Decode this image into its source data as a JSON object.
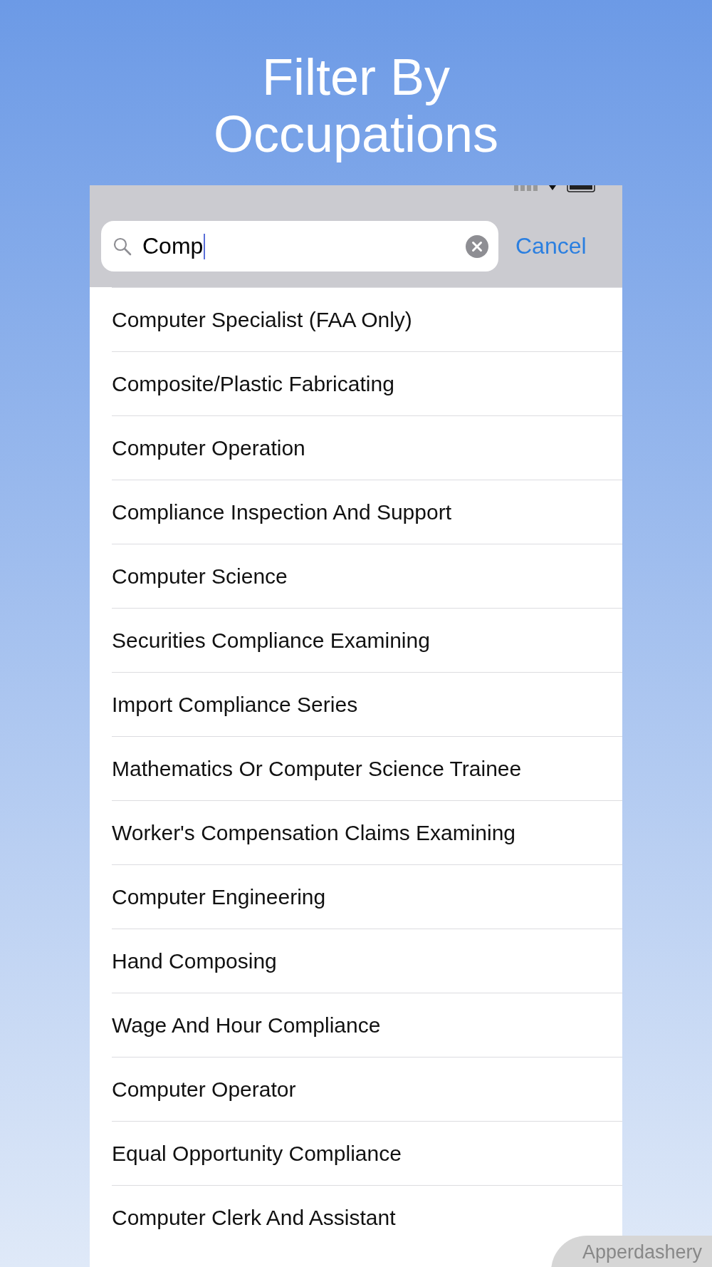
{
  "headline": "Filter By\nOccupations",
  "search": {
    "value": "Comp",
    "cancel": "Cancel"
  },
  "results": [
    {
      "label": "Computer Specialist (FAA Only)"
    },
    {
      "label": "Composite/Plastic Fabricating"
    },
    {
      "label": "Computer Operation"
    },
    {
      "label": "Compliance Inspection And Support"
    },
    {
      "label": "Computer Science"
    },
    {
      "label": "Securities Compliance Examining"
    },
    {
      "label": "Import Compliance Series"
    },
    {
      "label": "Mathematics Or Computer Science Trainee"
    },
    {
      "label": "Worker's Compensation Claims Examining"
    },
    {
      "label": "Computer Engineering"
    },
    {
      "label": "Hand Composing"
    },
    {
      "label": "Wage And Hour Compliance"
    },
    {
      "label": "Computer Operator"
    },
    {
      "label": "Equal Opportunity Compliance"
    },
    {
      "label": "Computer Clerk And Assistant"
    }
  ],
  "brand": "Apperdashery"
}
